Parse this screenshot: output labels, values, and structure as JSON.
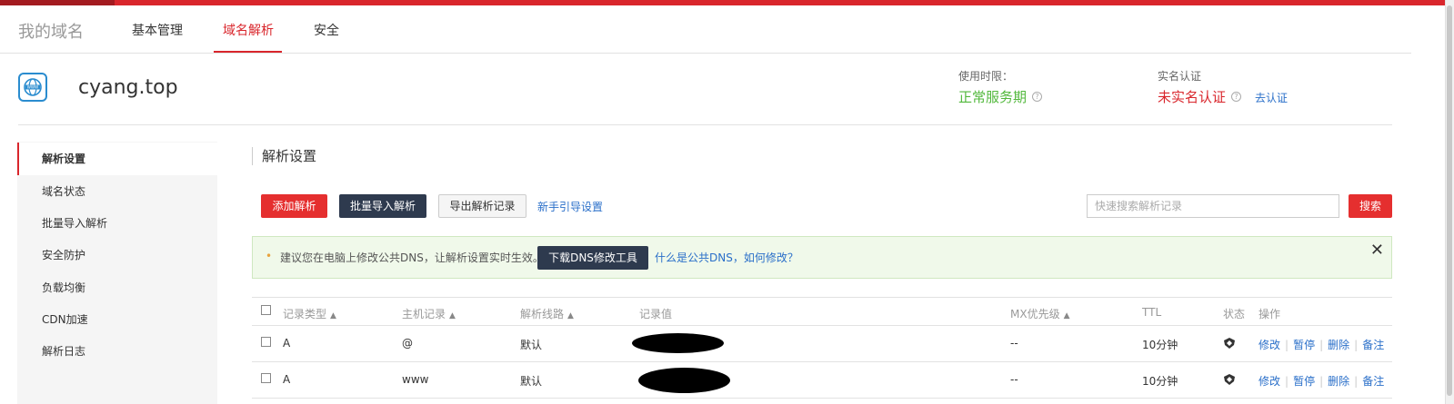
{
  "nav": {
    "brand": "我的域名",
    "tabs": [
      "基本管理",
      "域名解析",
      "安全"
    ],
    "active_tab": "域名解析"
  },
  "domain": {
    "name": "cyang.top",
    "logo_text": "WWW"
  },
  "usage": {
    "label": "使用时限：",
    "value": "正常服务期",
    "value_color": "#52b83c"
  },
  "realname": {
    "label": "实名认证",
    "value": "未实名认证",
    "value_color": "#d9262c",
    "link": "去认证"
  },
  "sidebar": {
    "items": [
      "解析设置",
      "域名状态",
      "批量导入解析",
      "安全防护",
      "负载均衡",
      "CDN加速",
      "解析日志"
    ],
    "active": "解析设置"
  },
  "section_title": "解析设置",
  "toolbar": {
    "add": "添加解析",
    "batch_import": "批量导入解析",
    "export": "导出解析记录",
    "guide_link": "新手引导设置",
    "search_placeholder": "快速搜索解析记录",
    "search_button": "搜索"
  },
  "notice": {
    "dot": "•",
    "text": "建议您在电脑上修改公共DNS，让解析设置实时生效。",
    "button": "下载DNS修改工具",
    "link": "什么是公共DNS，如何修改？",
    "close": "✕"
  },
  "table": {
    "headers": {
      "type": "记录类型",
      "host": "主机记录",
      "line": "解析线路",
      "value": "记录值",
      "mx": "MX优先级",
      "ttl": "TTL",
      "status": "状态",
      "ops": "操作"
    },
    "sort_glyph": "▲",
    "rows": [
      {
        "type": "A",
        "host": "@",
        "line": "默认",
        "mx": "--",
        "ttl": "10分钟"
      },
      {
        "type": "A",
        "host": "www",
        "line": "默认",
        "mx": "--",
        "ttl": "10分钟"
      }
    ],
    "actions": {
      "edit": "修改",
      "pause": "暂停",
      "delete": "删除",
      "note": "备注",
      "sep": "|"
    }
  },
  "colors": {
    "accent_red": "#d9262c",
    "dark_button": "#2e3a4e",
    "link_blue": "#2a6fc9"
  }
}
